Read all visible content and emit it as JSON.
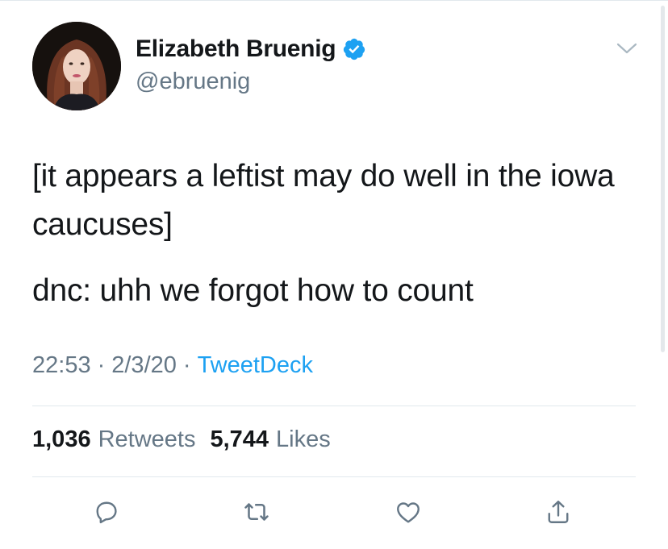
{
  "author": {
    "display_name": "Elizabeth Bruenig",
    "handle": "@ebruenig",
    "verified": true
  },
  "tweet": {
    "paragraphs": [
      "[it appears a leftist may do well in the iowa caucuses]",
      "dnc: uhh we forgot how to count"
    ],
    "time": "22:53",
    "date": "2/3/20",
    "separator": "·",
    "source": "TweetDeck"
  },
  "stats": {
    "retweets_count": "1,036",
    "retweets_label": "Retweets",
    "likes_count": "5,744",
    "likes_label": "Likes"
  },
  "colors": {
    "text": "#14171a",
    "muted": "#657786",
    "accent": "#1da1f2",
    "divider": "#e1e8ed"
  },
  "icons": {
    "verified": "verified-badge-icon",
    "menu": "chevron-down-icon",
    "reply": "reply-icon",
    "retweet": "retweet-icon",
    "like": "heart-icon",
    "share": "share-icon"
  }
}
